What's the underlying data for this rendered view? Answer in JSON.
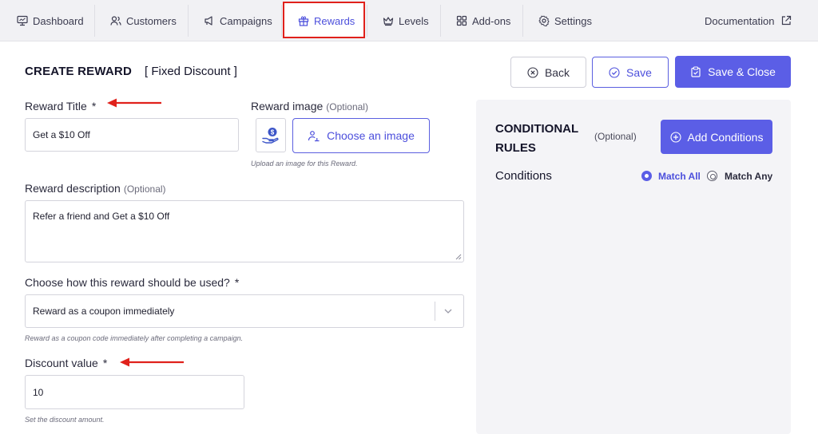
{
  "nav": {
    "dashboard": "Dashboard",
    "customers": "Customers",
    "campaigns": "Campaigns",
    "rewards": "Rewards",
    "levels": "Levels",
    "addons": "Add-ons",
    "settings": "Settings",
    "documentation": "Documentation"
  },
  "header": {
    "title": "CREATE REWARD",
    "subtitle": "[ Fixed Discount ]",
    "back_label": "Back",
    "save_label": "Save",
    "save_close_label": "Save & Close"
  },
  "form": {
    "title_label": "Reward Title",
    "required_mark": "*",
    "title_value": "Get a $10 Off",
    "image_label": "Reward image",
    "optional": "(Optional)",
    "choose_image_label": "Choose an image",
    "image_hint": "Upload an image for this Reward.",
    "description_label": "Reward description",
    "description_value": "Refer a friend and Get a $10 Off",
    "usage_label": "Choose how this reward should be used?",
    "usage_value": "Reward as a coupon immediately",
    "usage_hint": "Reward as a coupon code immediately after completing a campaign.",
    "discount_label": "Discount value",
    "discount_value": "10",
    "discount_hint": "Set the discount amount."
  },
  "conditions": {
    "title": "CONDITIONAL RULES",
    "optional": "(Optional)",
    "add_label": "Add Conditions",
    "conditions_label": "Conditions",
    "match_all": "Match All",
    "match_any": "Match Any"
  },
  "colors": {
    "accent": "#5b5ee6",
    "annotation": "#e0211b"
  }
}
